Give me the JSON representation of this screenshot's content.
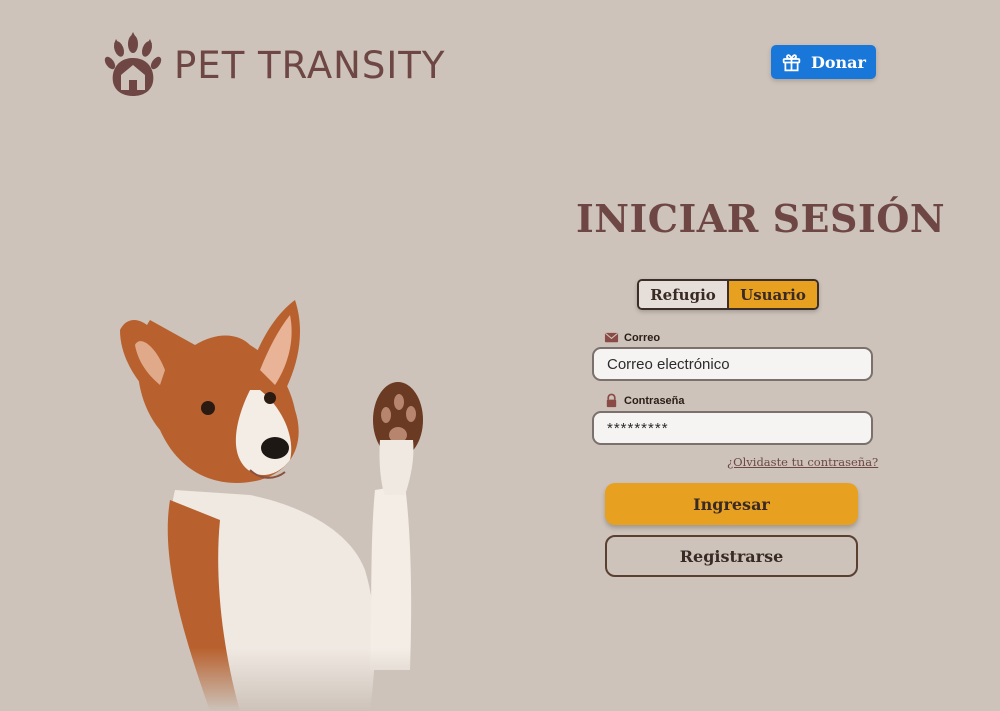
{
  "header": {
    "brand": "PET TRANSITY",
    "logo_icon": "paw-house-icon",
    "donate_label": "Donar",
    "donate_icon": "gift-icon"
  },
  "login": {
    "title": "INICIAR SESIÓN",
    "tabs": [
      {
        "label": "Refugio",
        "active": false
      },
      {
        "label": "Usuario",
        "active": true
      }
    ],
    "email": {
      "label": "Correo",
      "icon": "envelope-icon",
      "placeholder": "Correo electrónico",
      "value": ""
    },
    "password": {
      "label": "Contraseña",
      "icon": "lock-icon",
      "value": "*********"
    },
    "forgot_link": "¿Olvidaste tu contraseña?",
    "submit_label": "Ingresar",
    "register_label": "Registrarse"
  },
  "colors": {
    "background": "#cdc3ba",
    "brand": "#6e4744",
    "accent": "#e8a020",
    "donate": "#1877d9"
  }
}
